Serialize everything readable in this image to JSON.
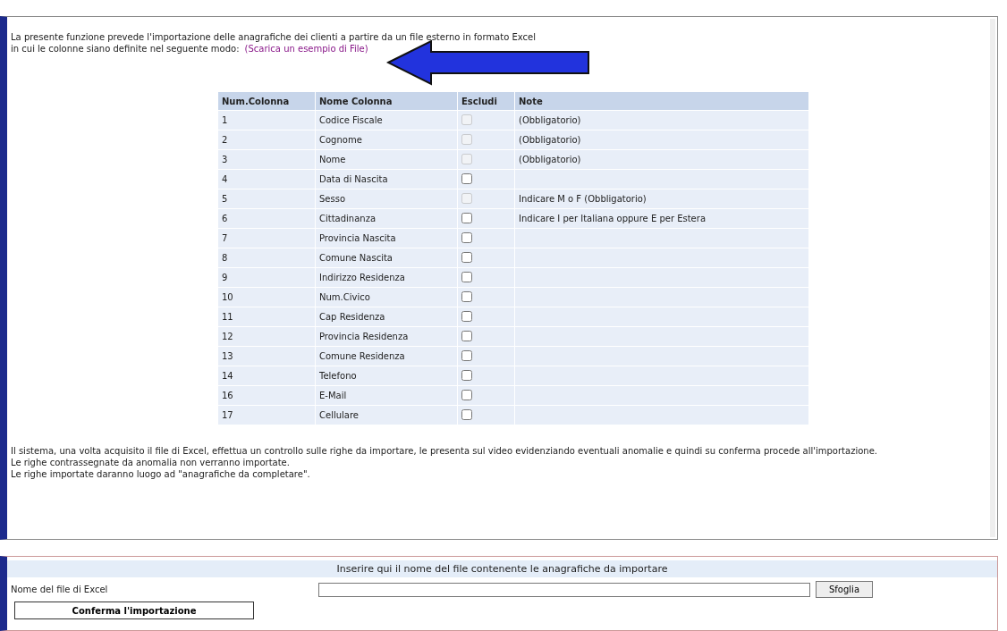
{
  "intro": {
    "line1": "La presente funzione prevede l'importazione delle anagrafiche dei clienti a partire da un file esterno in formato Excel",
    "line2": "in cui le colonne siano definite nel seguente modo:",
    "link": "(Scarica un esempio di File)"
  },
  "table": {
    "columns": [
      "Num.Colonna",
      "Nome Colonna",
      "Escludi",
      "Note"
    ],
    "rows": [
      {
        "num": "1",
        "name": "Codice Fiscale",
        "checked": false,
        "disabled": true,
        "note": "(Obbligatorio)"
      },
      {
        "num": "2",
        "name": "Cognome",
        "checked": false,
        "disabled": true,
        "note": "(Obbligatorio)"
      },
      {
        "num": "3",
        "name": "Nome",
        "checked": false,
        "disabled": true,
        "note": "(Obbligatorio)"
      },
      {
        "num": "4",
        "name": "Data di Nascita",
        "checked": false,
        "disabled": false
      },
      {
        "num": "5",
        "name": "Sesso",
        "checked": false,
        "disabled": true,
        "note": "Indicare M o F (Obbligatorio)"
      },
      {
        "num": "6",
        "name": "Cittadinanza",
        "checked": false,
        "disabled": false,
        "note": "Indicare I per Italiana oppure E per Estera"
      },
      {
        "num": "7",
        "name": "Provincia Nascita",
        "checked": false,
        "disabled": false
      },
      {
        "num": "8",
        "name": "Comune Nascita",
        "checked": false,
        "disabled": false
      },
      {
        "num": "9",
        "name": "Indirizzo Residenza",
        "checked": false,
        "disabled": false
      },
      {
        "num": "10",
        "name": "Num.Civico",
        "checked": false,
        "disabled": false
      },
      {
        "num": "11",
        "name": "Cap Residenza",
        "checked": false,
        "disabled": false
      },
      {
        "num": "12",
        "name": "Provincia Residenza",
        "checked": false,
        "disabled": false
      },
      {
        "num": "13",
        "name": "Comune Residenza",
        "checked": false,
        "disabled": false
      },
      {
        "num": "14",
        "name": "Telefono",
        "checked": false,
        "disabled": false
      },
      {
        "num": "16",
        "name": "E-Mail",
        "checked": false,
        "disabled": false
      },
      {
        "num": "17",
        "name": "Cellulare",
        "checked": false,
        "disabled": false
      }
    ]
  },
  "notes": [
    "Il sistema, una volta acquisito il file di Excel, effettua un controllo sulle righe da importare, le presenta sul video evidenziando eventuali anomalie e quindi su conferma procede all'importazione.",
    "Le righe contrassegnate da anomalia non verranno importate.",
    "Le righe importate daranno luogo ad \"anagrafiche da completare\"."
  ],
  "upload": {
    "title": "Inserire qui il nome del file contenente le anagrafiche da importare",
    "label": "Nome del file di Excel",
    "browse": "Sfoglia",
    "confirm": "Conferma l'importazione"
  }
}
